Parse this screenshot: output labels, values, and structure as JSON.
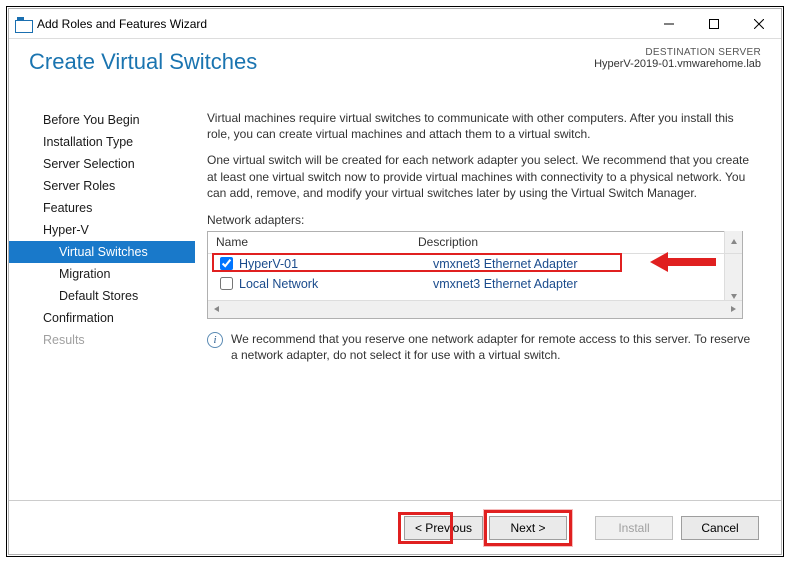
{
  "window": {
    "title": "Add Roles and Features Wizard"
  },
  "header": {
    "page_title": "Create Virtual Switches",
    "dest_label": "DESTINATION SERVER",
    "dest_value": "HyperV-2019-01.vmwarehome.lab"
  },
  "sidebar": {
    "items": [
      {
        "label": "Before You Begin",
        "selected": false
      },
      {
        "label": "Installation Type",
        "selected": false
      },
      {
        "label": "Server Selection",
        "selected": false
      },
      {
        "label": "Server Roles",
        "selected": false
      },
      {
        "label": "Features",
        "selected": false
      },
      {
        "label": "Hyper-V",
        "selected": false
      },
      {
        "label": "Virtual Switches",
        "selected": true,
        "sub": true
      },
      {
        "label": "Migration",
        "selected": false,
        "sub": true
      },
      {
        "label": "Default Stores",
        "selected": false,
        "sub": true
      },
      {
        "label": "Confirmation",
        "selected": false
      },
      {
        "label": "Results",
        "selected": false,
        "disabled": true
      }
    ]
  },
  "main": {
    "para1": "Virtual machines require virtual switches to communicate with other computers. After you install this role, you can create virtual machines and attach them to a virtual switch.",
    "para2": "One virtual switch will be created for each network adapter you select. We recommend that you create at least one virtual switch now to provide virtual machines with connectivity to a physical network. You can add, remove, and modify your virtual switches later by using the Virtual Switch Manager.",
    "adapters_label": "Network adapters:",
    "columns": {
      "name": "Name",
      "description": "Description"
    },
    "adapters": [
      {
        "name": "HyperV-01",
        "description": "vmxnet3 Ethernet Adapter",
        "checked": true
      },
      {
        "name": "Local Network",
        "description": "vmxnet3 Ethernet Adapter",
        "checked": false
      }
    ],
    "info_text": "We recommend that you reserve one network adapter for remote access to this server. To reserve a network adapter, do not select it for use with a virtual switch."
  },
  "buttons": {
    "previous": "< Previous",
    "next": "Next >",
    "install": "Install",
    "cancel": "Cancel"
  }
}
